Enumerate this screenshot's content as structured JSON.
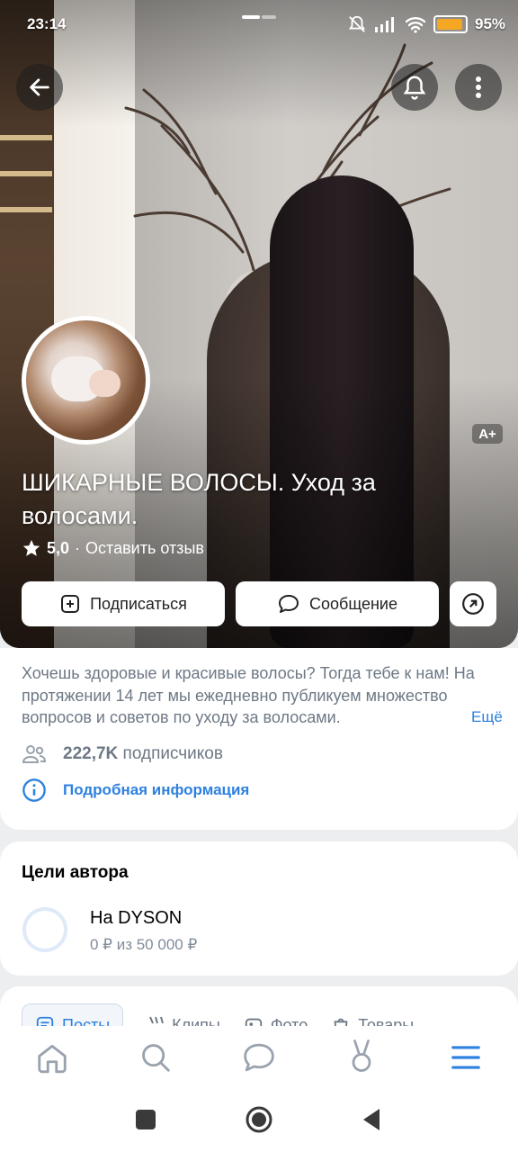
{
  "status_bar": {
    "time": "23:14",
    "battery": "95%"
  },
  "profile": {
    "title": "ШИКАРНЫЕ ВОЛОСЫ. Уход за волосами.",
    "rating": "5,0",
    "rating_separator": "·",
    "review_link": "Оставить отзыв",
    "age_badge": "A+",
    "subscribe_label": "Подписаться",
    "message_label": "Сообщение"
  },
  "about": {
    "description": "Хочешь здоровые и красивые волосы? Тогда тебе к нам! На протяжении 14 лет мы ежедневно публикуем множество вопросов и советов по уходу за волосами.",
    "more_label": "Ещё",
    "followers": "222,7K",
    "followers_suffix": " подписчиков",
    "details_link": "Подробная информация"
  },
  "goals": {
    "heading": "Цели автора",
    "items": [
      {
        "name": "На DYSON",
        "progress_text": "0 ₽ из 50 000 ₽",
        "progress": 0
      }
    ]
  },
  "tabs": [
    "Посты",
    "Клипы",
    "Фото",
    "Товары"
  ],
  "nav": {
    "icons": [
      "home-icon",
      "search-icon",
      "messages-icon",
      "services-icon",
      "menu-icon"
    ]
  },
  "colors": {
    "accent": "#2d81e0",
    "muted": "#6d7885",
    "page_bg": "#edeef0"
  }
}
